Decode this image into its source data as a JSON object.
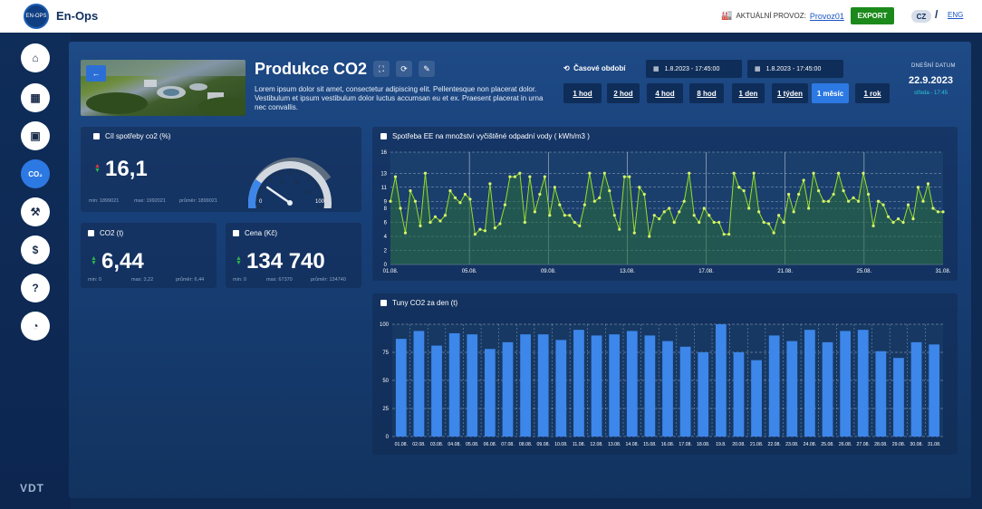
{
  "app": {
    "brand": "En-Ops",
    "logo_text": "EN-OPS"
  },
  "topbar": {
    "provoz_label": "AKTUÁLNÍ PROVOZ:",
    "provoz_value": "Provoz01",
    "export_label": "EXPORT",
    "lang_cz": "CZ",
    "lang_sep": "/",
    "lang_eng": "ENG"
  },
  "sidebar": {
    "items": [
      {
        "name": "home-icon",
        "glyph": "⌂"
      },
      {
        "name": "calendar-icon",
        "glyph": "▦"
      },
      {
        "name": "calendar-check-icon",
        "glyph": "▣"
      },
      {
        "name": "co2-icon",
        "glyph": "CO₂"
      },
      {
        "name": "factory-arm-icon",
        "glyph": "⚒"
      },
      {
        "name": "dollar-icon",
        "glyph": "$"
      },
      {
        "name": "help-icon",
        "glyph": "?"
      },
      {
        "name": "gauge-icon",
        "glyph": "◔"
      }
    ],
    "footer_logo": "VDT"
  },
  "header": {
    "title": "Produkce CO2",
    "description": "Lorem ipsum dolor sit amet, consectetur adipiscing elit. Pellentesque non placerat dolor. Vestibulum et ipsum vestibulum dolor luctus accumsan eu et ex. Praesent placerat in urna nec convallis.",
    "period_label": "Časové období",
    "date_from": "1.8.2023 - 17:45:00",
    "date_to": "1.8.2023 - 17:45:00",
    "period_buttons": [
      "1 hod",
      "2 hod",
      "4 hod",
      "8 hod",
      "1 den",
      "1 týden",
      "1 měsíc",
      "1 rok"
    ],
    "active_period": "1 měsíc",
    "today_label": "DNEŠNÍ DATUM",
    "today_date": "22.9.2023",
    "today_day": "středa - 17:45"
  },
  "cards": {
    "goal": {
      "title": "Cíl spotřeby co2 (%)",
      "value": "16,1",
      "min": "min: 1899021",
      "max": "max: 1992021",
      "avg": "průměr: 1899021",
      "gauge": {
        "value": 22,
        "min_label": "0",
        "max_label": "100",
        "ticks": [
          "20",
          "40",
          "60",
          "80"
        ]
      }
    },
    "co2": {
      "title": "CO2 (t)",
      "value": "6,44",
      "min": "min: 0",
      "max": "max: 3,22",
      "avg": "průměr: 6,44"
    },
    "cena": {
      "title": "Cena (Kč)",
      "value": "134 740",
      "min": "min: 0",
      "max": "max: 67370",
      "avg": "průměr: 134740"
    }
  },
  "colors": {
    "accent": "#2d79e3",
    "line": "#9bdc2a",
    "bar": "#3d86ea",
    "green_arrow": "#2fb34a",
    "red_arrow": "#e03a3a"
  },
  "chart_data": [
    {
      "type": "line",
      "title": "Spotřeba EE na množství vyčištěné odpadní vody ( kWh/m3 )",
      "ylim": [
        0,
        16
      ],
      "yticks": [
        0,
        2,
        4,
        6,
        8,
        9,
        11,
        13,
        16
      ],
      "xtick_labels": [
        "01.08.",
        "05.08.",
        "09.08.",
        "13.08.",
        "17.08.",
        "21.08.",
        "25.08.",
        "31.08."
      ],
      "values": [
        9,
        12.5,
        8,
        4.5,
        10.5,
        9,
        5.5,
        13,
        6,
        6.8,
        6.2,
        7,
        10.5,
        9.5,
        8.8,
        10,
        9.3,
        4.3,
        5,
        4.8,
        11.5,
        5.2,
        5.8,
        8.5,
        12.5,
        12.5,
        13,
        6,
        12.5,
        7.5,
        10,
        12.5,
        7,
        11,
        8.5,
        7,
        7,
        6,
        5.5,
        8.5,
        13,
        9,
        9.5,
        13,
        10.5,
        7,
        5,
        12.5,
        12.5,
        4.5,
        11,
        10,
        4,
        7,
        6.5,
        7.5,
        8,
        6,
        7.5,
        9,
        13,
        7,
        6,
        8,
        7,
        6,
        6,
        4.3,
        4.3,
        13,
        11,
        10.5,
        8,
        13,
        7.5,
        6,
        5.8,
        4.5,
        7,
        6,
        10,
        7.5,
        10,
        12,
        8,
        13,
        10.5,
        9,
        9,
        10,
        13,
        10.5,
        9,
        9.5,
        9,
        13,
        10,
        5.5,
        9,
        8.5,
        6.8,
        6,
        6.5,
        6,
        8.5,
        6.5,
        11,
        9,
        11.5,
        8,
        7.5,
        7.5
      ]
    },
    {
      "type": "bar",
      "title": "Tuny CO2 za den (t)",
      "ylim": [
        0,
        100
      ],
      "yticks": [
        0,
        25,
        50,
        75,
        100
      ],
      "categories": [
        "01.08.",
        "02.08.",
        "03.08.",
        "04.08.",
        "05.08.",
        "06.08.",
        "07.08.",
        "08.08.",
        "09.08.",
        "10.08.",
        "11.08.",
        "12.08.",
        "13.08.",
        "14.08.",
        "15.08.",
        "16.08.",
        "17.08.",
        "18.08.",
        "19.8.",
        "20.08.",
        "21.08.",
        "22.08.",
        "23.08.",
        "24.08.",
        "25.08.",
        "26.08.",
        "27.08.",
        "28.08.",
        "29.08.",
        "30.08.",
        "31.08."
      ],
      "values": [
        87,
        94,
        81,
        92,
        91,
        78,
        84,
        91,
        91,
        86,
        95,
        90,
        91,
        94,
        90,
        85,
        80,
        75,
        100,
        75,
        68,
        90,
        85,
        95,
        84,
        94,
        95,
        76,
        70,
        84,
        82
      ]
    }
  ]
}
